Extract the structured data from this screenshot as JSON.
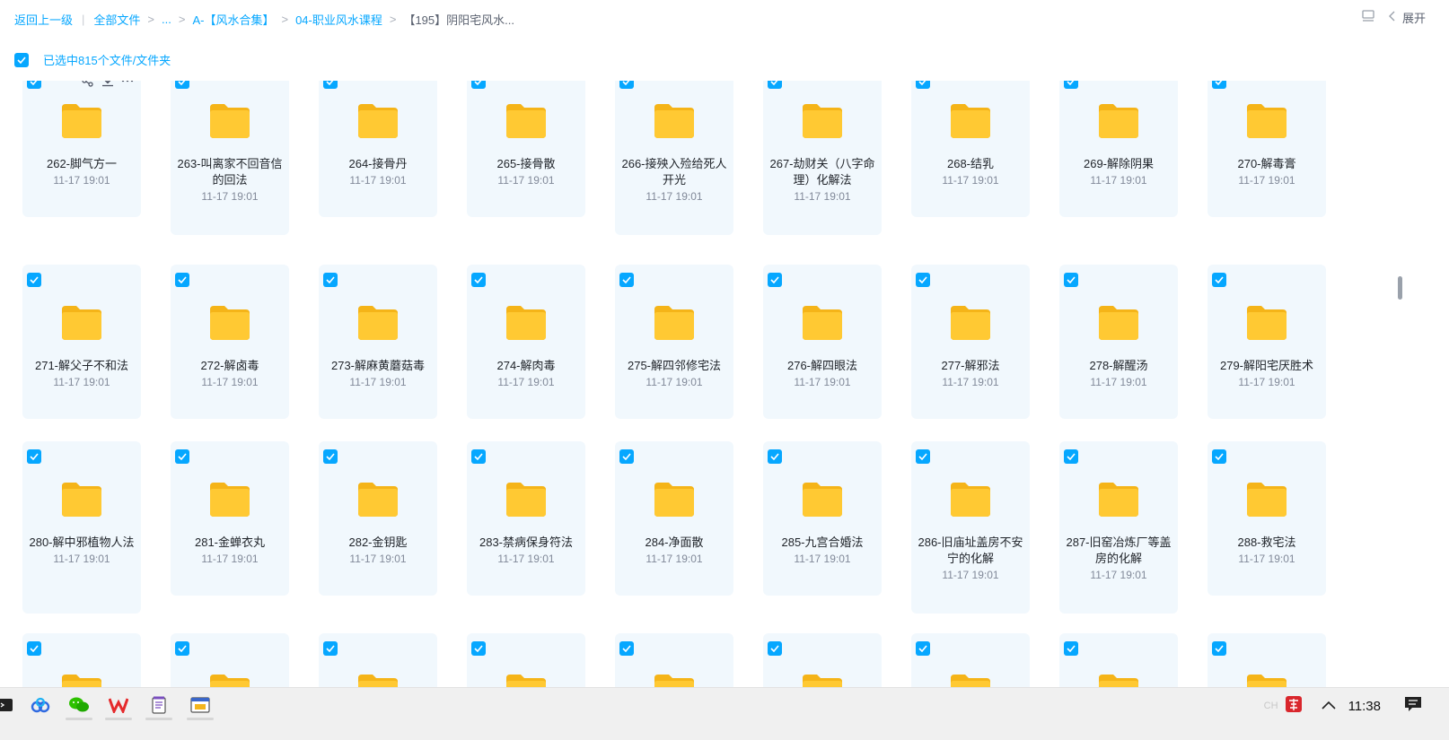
{
  "breadcrumb": {
    "back": "返回上一级",
    "all_files": "全部文件",
    "ellipsis": "...",
    "level1": "A-【风水合集】",
    "level2": "04-职业风水课程",
    "current": "【195】阴阳宅风水..."
  },
  "header": {
    "expand_label": "展开"
  },
  "selection": {
    "label": "已选中815个文件/文件夹"
  },
  "colors": {
    "accent": "#06a7ff",
    "card_bg": "#f1f8fd",
    "folder": "#ffc52e"
  },
  "files": [
    {
      "name": "262-脚气方一",
      "time": "11-17 19:01"
    },
    {
      "name": "263-叫离家不回音信的回法",
      "time": "11-17 19:01"
    },
    {
      "name": "264-接骨丹",
      "time": "11-17 19:01"
    },
    {
      "name": "265-接骨散",
      "time": "11-17 19:01"
    },
    {
      "name": "266-接殃入殓给死人开光",
      "time": "11-17 19:01"
    },
    {
      "name": "267-劫财关（八字命理）化解法",
      "time": "11-17 19:01"
    },
    {
      "name": "268-结乳",
      "time": "11-17 19:01"
    },
    {
      "name": "269-解除阴果",
      "time": "11-17 19:01"
    },
    {
      "name": "270-解毒膏",
      "time": "11-17 19:01"
    },
    {
      "name": "271-解父子不和法",
      "time": "11-17 19:01"
    },
    {
      "name": "272-解卤毒",
      "time": "11-17 19:01"
    },
    {
      "name": "273-解麻黄蘑菇毒",
      "time": "11-17 19:01"
    },
    {
      "name": "274-解肉毒",
      "time": "11-17 19:01"
    },
    {
      "name": "275-解四邻修宅法",
      "time": "11-17 19:01"
    },
    {
      "name": "276-解四眼法",
      "time": "11-17 19:01"
    },
    {
      "name": "277-解邪法",
      "time": "11-17 19:01"
    },
    {
      "name": "278-解醒汤",
      "time": "11-17 19:01"
    },
    {
      "name": "279-解阳宅厌胜术",
      "time": "11-17 19:01"
    },
    {
      "name": "280-解中邪植物人法",
      "time": "11-17 19:01"
    },
    {
      "name": "281-金蝉衣丸",
      "time": "11-17 19:01"
    },
    {
      "name": "282-金钥匙",
      "time": "11-17 19:01"
    },
    {
      "name": "283-禁病保身符法",
      "time": "11-17 19:01"
    },
    {
      "name": "284-净面散",
      "time": "11-17 19:01"
    },
    {
      "name": "285-九宫合婚法",
      "time": "11-17 19:01"
    },
    {
      "name": "286-旧庙址盖房不安宁的化解",
      "time": "11-17 19:01"
    },
    {
      "name": "287-旧窑冶炼厂等盖房的化解",
      "time": "11-17 19:01"
    },
    {
      "name": "288-救宅法",
      "time": "11-17 19:01"
    },
    {
      "name": "",
      "time": ""
    },
    {
      "name": "",
      "time": ""
    },
    {
      "name": "",
      "time": ""
    },
    {
      "name": "",
      "time": ""
    },
    {
      "name": "",
      "time": ""
    },
    {
      "name": "",
      "time": ""
    },
    {
      "name": "",
      "time": ""
    },
    {
      "name": "",
      "time": ""
    },
    {
      "name": "",
      "time": ""
    }
  ],
  "taskbar": {
    "apps": [
      "terminal-icon",
      "baidu-netdisk-icon",
      "wechat-icon",
      "wps-icon",
      "notepad-icon",
      "file-manager-icon"
    ],
    "ime": "CH",
    "time": "11:38"
  }
}
